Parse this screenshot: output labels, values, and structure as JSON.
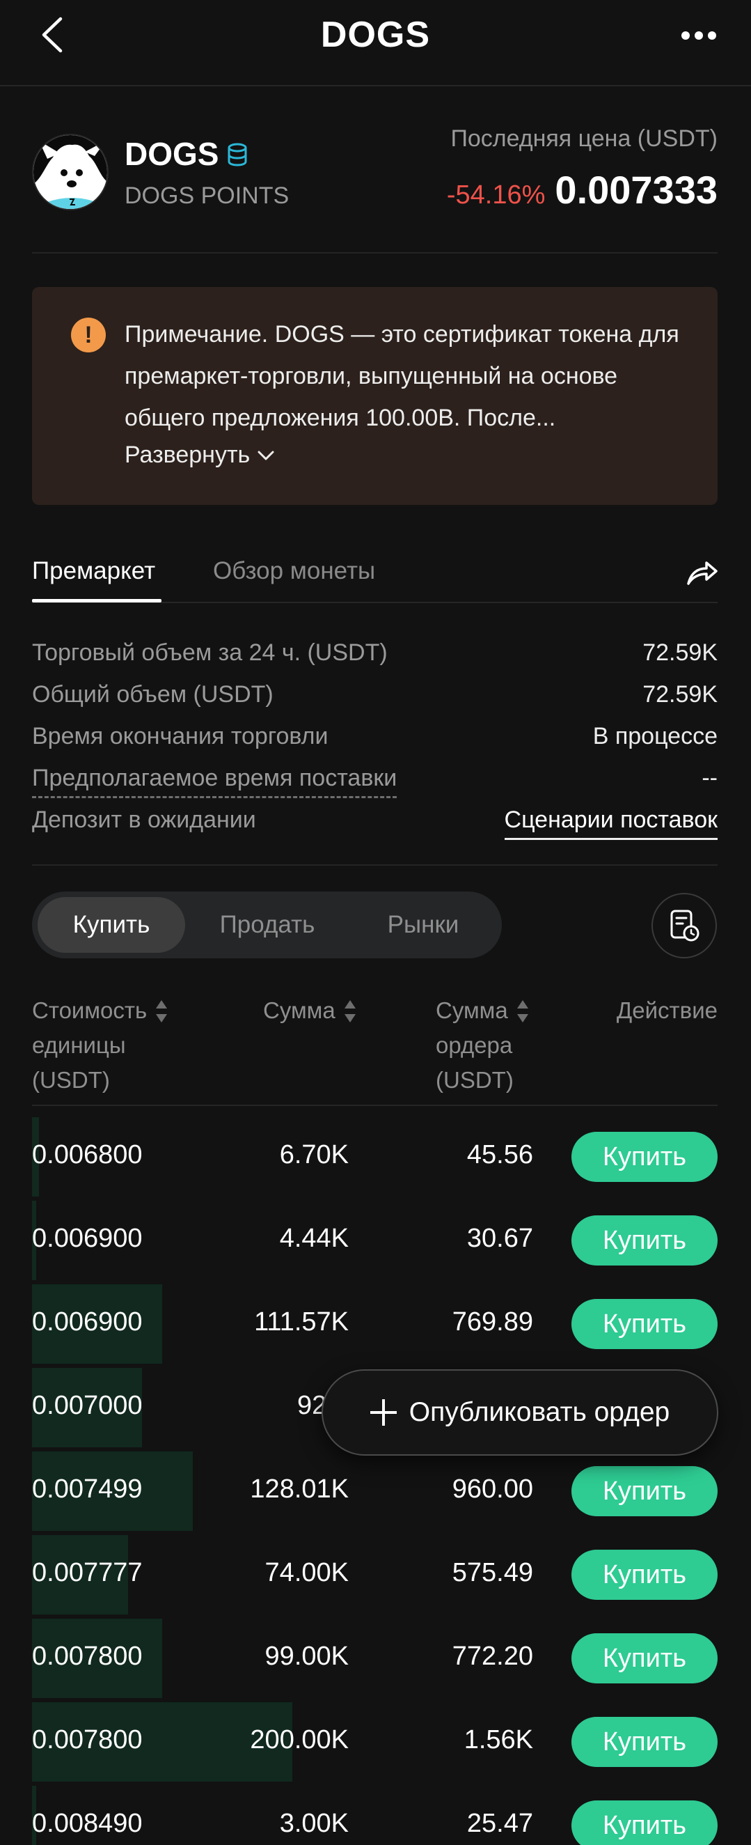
{
  "header": {
    "title": "DOGS"
  },
  "token": {
    "name": "DOGS",
    "subtitle": "DOGS POINTS",
    "price_label": "Последняя цена (USDT)",
    "change": "-54.16%",
    "price": "0.007333"
  },
  "notice": {
    "text": "Примечание. DOGS — это сертификат токена для премаркет-торговли, выпущенный на основе общего предложения 100.00B. После...",
    "expand_label": "Развернуть"
  },
  "tabs": [
    {
      "label": "Премаркет"
    },
    {
      "label": "Обзор монеты"
    }
  ],
  "info": [
    {
      "label": "Торговый объем за 24 ч. (USDT)",
      "value": "72.59K"
    },
    {
      "label": "Общий объем (USDT)",
      "value": "72.59K"
    },
    {
      "label": "Время окончания торговли",
      "value": "В процессе"
    },
    {
      "label": "Предполагаемое время поставки",
      "value": "--"
    },
    {
      "label": "Депозит в ожидании",
      "value": "Сценарии поставок"
    }
  ],
  "segments": [
    {
      "label": "Купить"
    },
    {
      "label": "Продать"
    },
    {
      "label": "Рынки"
    }
  ],
  "table": {
    "col_price": [
      "Стоимость",
      "единицы",
      "(USDT)"
    ],
    "col_amount": "Сумма",
    "col_total": [
      "Сумма",
      "ордера",
      "(USDT)"
    ],
    "col_action": "Действие"
  },
  "orders": [
    {
      "price": "0.006800",
      "amount": "6.70K",
      "total": "45.56",
      "action": "Купить",
      "depth": 0.01
    },
    {
      "price": "0.006900",
      "amount": "4.44K",
      "total": "30.67",
      "action": "Купить",
      "depth": 0.005
    },
    {
      "price": "0.006900",
      "amount": "111.57K",
      "total": "769.89",
      "action": "Купить",
      "depth": 0.19
    },
    {
      "price": "0.007000",
      "amount": "92.0",
      "total": "",
      "action": "Купить",
      "depth": 0.16
    },
    {
      "price": "0.007499",
      "amount": "128.01K",
      "total": "960.00",
      "action": "Купить",
      "depth": 0.235
    },
    {
      "price": "0.007777",
      "amount": "74.00K",
      "total": "575.49",
      "action": "Купить",
      "depth": 0.14
    },
    {
      "price": "0.007800",
      "amount": "99.00K",
      "total": "772.20",
      "action": "Купить",
      "depth": 0.19
    },
    {
      "price": "0.007800",
      "amount": "200.00K",
      "total": "1.56K",
      "action": "Купить",
      "depth": 0.38
    },
    {
      "price": "0.008490",
      "amount": "3.00K",
      "total": "25.47",
      "action": "Купить",
      "depth": 0.005
    }
  ],
  "fab": {
    "label": "Опубликовать ордер"
  },
  "colors": {
    "buy": "#2ecb93",
    "negative": "#f0524a",
    "notice_bg": "#2c211c",
    "depth": "#11291f"
  }
}
